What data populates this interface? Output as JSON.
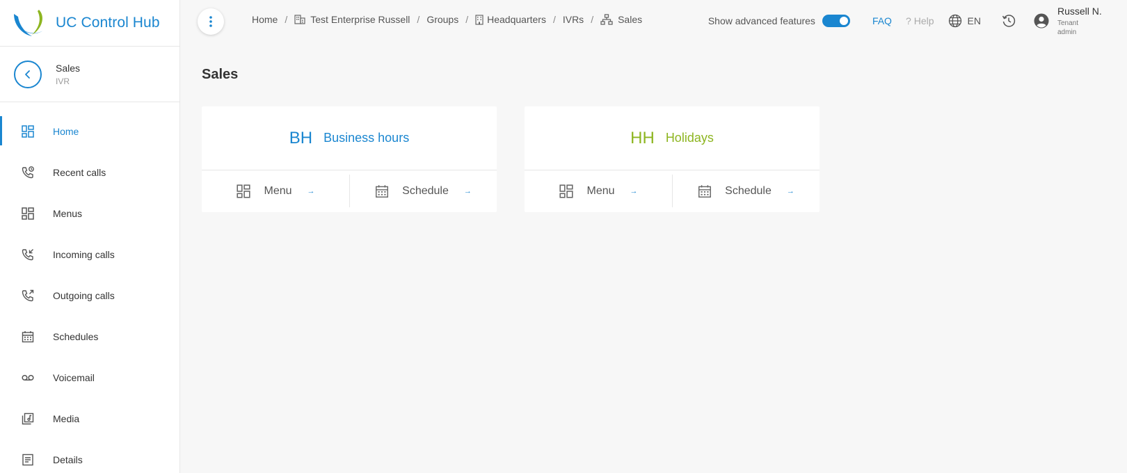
{
  "brand": {
    "name": "UC Control Hub"
  },
  "context": {
    "title": "Sales",
    "subtitle": "IVR"
  },
  "sidebar": {
    "items": [
      {
        "label": "Home",
        "icon": "dashboard-icon"
      },
      {
        "label": "Recent calls",
        "icon": "phone-clock-icon"
      },
      {
        "label": "Menus",
        "icon": "dashboard-icon"
      },
      {
        "label": "Incoming calls",
        "icon": "phone-incoming-icon"
      },
      {
        "label": "Outgoing calls",
        "icon": "phone-outgoing-icon"
      },
      {
        "label": "Schedules",
        "icon": "calendar-icon"
      },
      {
        "label": "Voicemail",
        "icon": "voicemail-icon"
      },
      {
        "label": "Media",
        "icon": "media-library-icon"
      },
      {
        "label": "Details",
        "icon": "document-icon"
      }
    ]
  },
  "breadcrumb": {
    "home": "Home",
    "enterprise": "Test Enterprise Russell",
    "groups": "Groups",
    "group": "Headquarters",
    "ivrs": "IVRs",
    "current": "Sales",
    "separator": "/"
  },
  "header": {
    "advanced_label": "Show advanced features",
    "advanced_enabled": true,
    "faq": "FAQ",
    "help_mark": "?",
    "help": "Help",
    "language": "EN",
    "user_name": "Russell N.",
    "user_role": "Tenant admin"
  },
  "page": {
    "title": "Sales"
  },
  "cards": [
    {
      "abbr": "BH",
      "name": "Business hours",
      "color": "#1a86d0",
      "menu_label": "Menu",
      "schedule_label": "Schedule",
      "arrow": "→"
    },
    {
      "abbr": "HH",
      "name": "Holidays",
      "color": "#8db520",
      "menu_label": "Menu",
      "schedule_label": "Schedule",
      "arrow": "→"
    }
  ],
  "colors": {
    "accent": "#1a86d0",
    "holiday": "#8db520"
  }
}
